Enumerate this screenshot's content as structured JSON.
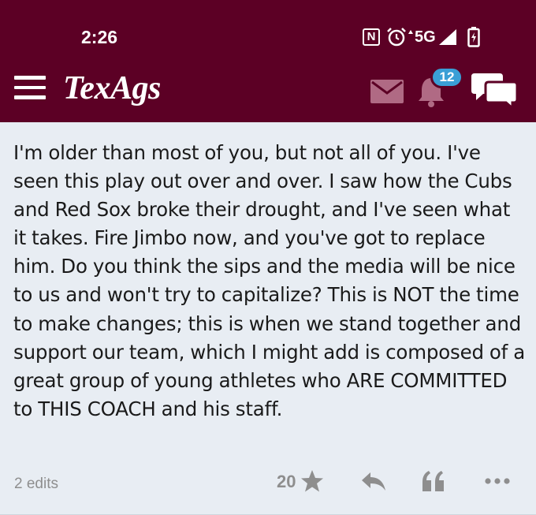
{
  "status_bar": {
    "time": "2:26",
    "nfc_label": "N",
    "network": "5G"
  },
  "header": {
    "logo": "TexAgs",
    "notification_count": "12",
    "icons": [
      "menu-icon",
      "mail-icon",
      "bell-icon",
      "chat-icon"
    ]
  },
  "post": {
    "body": "I'm older than most of you, but not all of you. I've seen this play out over and over. I saw how the Cubs and Red Sox broke their drought, and I've seen what it takes. Fire Jimbo now, and you've got to replace him. Do you think the sips and the media will be nice to us and won't try to capitalize? This is NOT the time to make changes; this is when we stand together and support our team, which I might add is composed of a great group of young athletes who ARE COMMITTED to THIS COACH and his staff.",
    "edits": "2 edits",
    "star_count": "20",
    "actions": [
      "star-icon",
      "reply-icon",
      "quote-icon",
      "more-icon"
    ]
  },
  "colors": {
    "header_bg": "#5c0025",
    "post_bg": "#e8edf3",
    "badge_bg": "#3a9fd6",
    "muted_icon": "#8e8e8e",
    "header_muted_icon": "#b06a84"
  }
}
